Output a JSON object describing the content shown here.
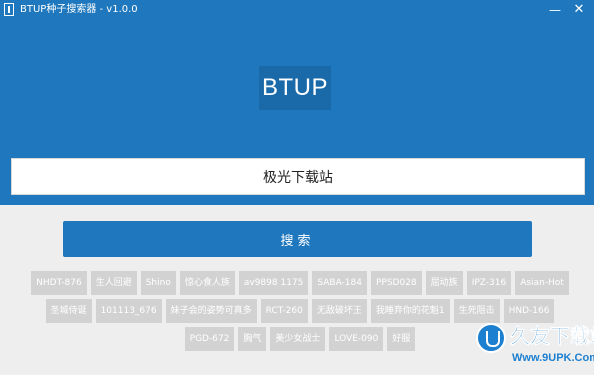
{
  "window": {
    "title": "BTUP种子搜索器 - v1.0.0",
    "minimize_glyph": "—",
    "close_glyph": "✕"
  },
  "header": {
    "logo_text": "BTUP"
  },
  "search": {
    "value": "极光下载站",
    "button_label": "搜索"
  },
  "tags": {
    "rows": [
      [
        "NHDT-876",
        "生人回避",
        "Shino",
        "惊心食人族",
        "av9898 1175",
        "SABA-184",
        "PPSD028",
        "屈动族",
        "IPZ-316",
        "Asian-Hot"
      ],
      [
        "圣城侍诞",
        "101113_676",
        "妹子会的姿势可真多",
        "RCT-260",
        "无敌破坏王",
        "我睡弃你的花魁1",
        "生死阻击",
        "HND-166"
      ],
      [
        "PGD-672",
        "胸气",
        "美少女战士",
        "LOVE-090",
        "好服"
      ]
    ]
  },
  "watermark": {
    "text": "久友下载站",
    "url": "Www.9UPK.Com"
  },
  "colors": {
    "brand_blue": "#1f78be",
    "tag_gray": "#d2d2d2",
    "background": "#eeeeee"
  },
  "icons": {
    "app": "app-logo-icon",
    "minimize": "minimize-icon",
    "close": "close-icon",
    "watermark": "watermark-logo-icon"
  }
}
